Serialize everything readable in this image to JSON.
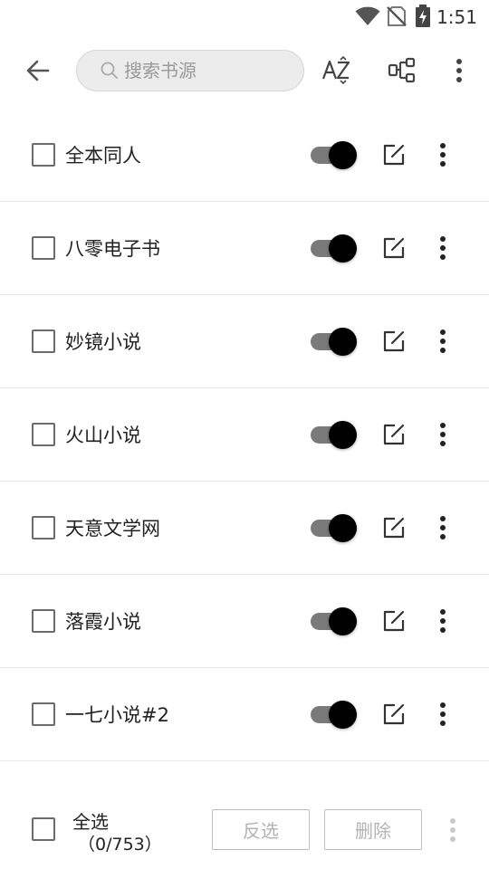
{
  "status_bar": {
    "time": "1:51",
    "icons": [
      "wifi-icon",
      "no-sim-icon",
      "battery-charging-icon"
    ]
  },
  "toolbar": {
    "back_icon": "arrow-left-icon",
    "search_placeholder": "搜索书源",
    "sort_icon": "sort-az-icon",
    "group_icon": "group-icon",
    "menu_icon": "more-vert-icon"
  },
  "sources": [
    {
      "name": "全本同人",
      "checked": false,
      "enabled": true
    },
    {
      "name": "八零电子书",
      "checked": false,
      "enabled": true
    },
    {
      "name": "妙镜小说",
      "checked": false,
      "enabled": true
    },
    {
      "name": "火山小说",
      "checked": false,
      "enabled": true
    },
    {
      "name": "天意文学网",
      "checked": false,
      "enabled": true
    },
    {
      "name": "落霞小说",
      "checked": false,
      "enabled": true
    },
    {
      "name": "一七小说#2",
      "checked": false,
      "enabled": true
    }
  ],
  "bottom_bar": {
    "select_all_label": "全选",
    "count": "（0/753）",
    "invert_label": "反选",
    "delete_label": "删除"
  },
  "colors": {
    "switch_track": "#7a7a7a",
    "switch_thumb": "#000000",
    "divider": "#e8e8e8",
    "disabled_text": "#b3b3b3"
  }
}
